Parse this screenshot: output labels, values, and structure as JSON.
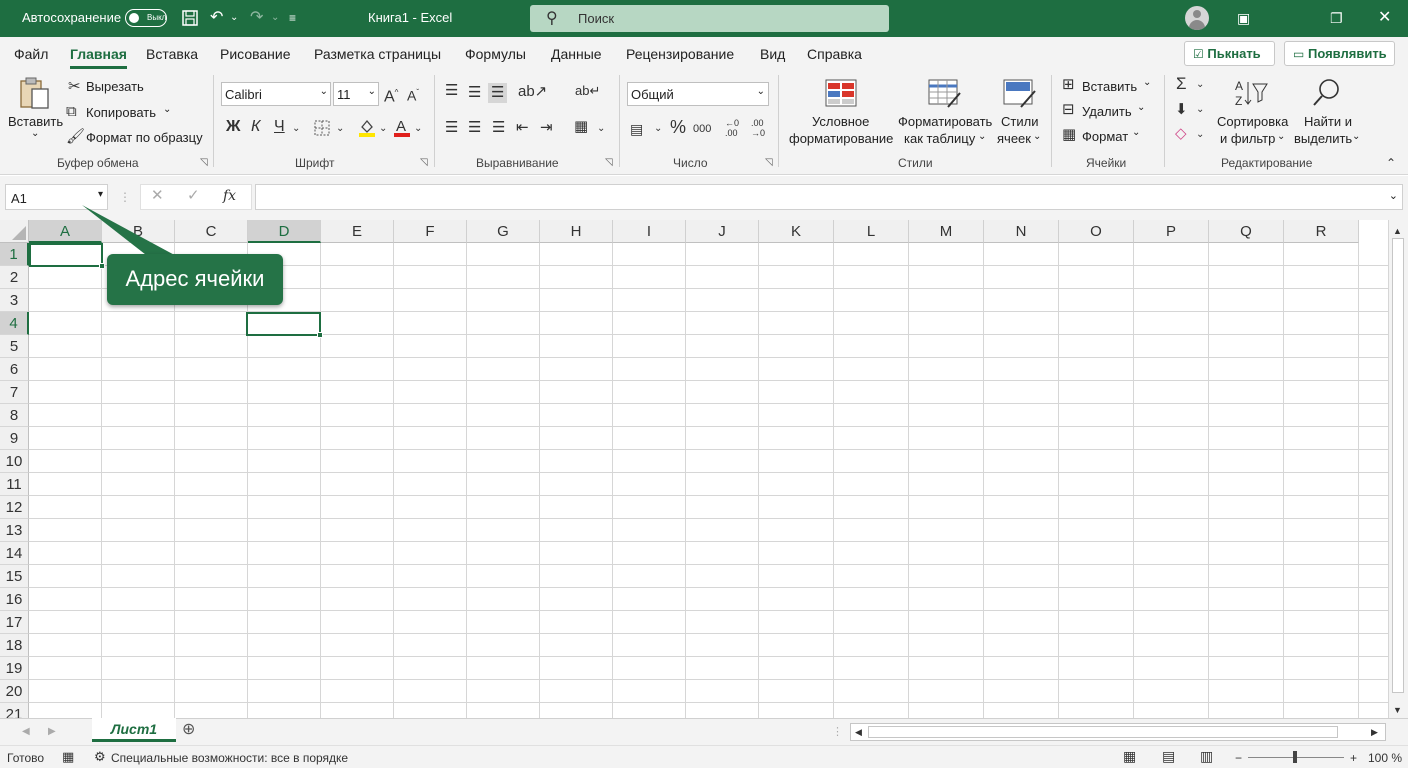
{
  "titlebar": {
    "autosave_label": "Автосохранение",
    "autosave_state": "Выкл",
    "doc_title": "Книга1  -  Excel",
    "search_placeholder": "Поиск",
    "bg_color": "#1e6e41"
  },
  "menu": {
    "items": [
      "Файл",
      "Главная",
      "Вставка",
      "Рисование",
      "Разметка страницы",
      "Формулы",
      "Данные",
      "Рецензирование",
      "Вид",
      "Справка"
    ],
    "active": "Главная",
    "share_button": "Пькнать",
    "comments_button": "Появлявить"
  },
  "ribbon": {
    "clipboard": {
      "paste": "Вставить",
      "cut": "Вырезать",
      "copy": "Копировать",
      "format_painter": "Формат по образцу",
      "group_label": "Буфер обмена"
    },
    "font": {
      "font_name": "Calibri",
      "font_size": "11",
      "bold": "Ж",
      "italic": "К",
      "underline": "Ч",
      "group_label": "Шрифт"
    },
    "alignment": {
      "group_label": "Выравнивание"
    },
    "number": {
      "format": "Общий",
      "percent": "%",
      "group_label": "Число"
    },
    "styles": {
      "conditional_line1": "Условное",
      "conditional_line2": "форматирование",
      "as_table_line1": "Форматировать",
      "as_table_line2": "как таблицу",
      "cell_styles_line1": "Стили",
      "cell_styles_line2": "ячеек",
      "group_label": "Стили"
    },
    "cells": {
      "insert": "Вставить",
      "delete": "Удалить",
      "format": "Формат",
      "group_label": "Ячейки"
    },
    "editing": {
      "sort_line1": "Сортировка",
      "sort_line2": "и фильтр",
      "find_line1": "Найти и",
      "find_line2": "выделить",
      "group_label": "Редактирование"
    }
  },
  "formula_bar": {
    "name_box": "A1",
    "fx": "fx",
    "formula": ""
  },
  "grid": {
    "columns": [
      "A",
      "B",
      "C",
      "D",
      "E",
      "F",
      "G",
      "H",
      "I",
      "J",
      "K",
      "L",
      "M",
      "N",
      "O",
      "P",
      "Q",
      "R"
    ],
    "rows": [
      "1",
      "2",
      "3",
      "4",
      "5",
      "6",
      "7",
      "8",
      "9",
      "10",
      "11",
      "12",
      "13",
      "14",
      "15",
      "16",
      "17",
      "18",
      "19",
      "20",
      "21"
    ],
    "active_cell": "A1",
    "selected_cell": "D4"
  },
  "callout": {
    "text": "Адрес ячейки",
    "color": "#257347"
  },
  "sheets": {
    "tabs": [
      "Лист1"
    ],
    "active": "Лист1"
  },
  "status": {
    "ready": "Готово",
    "accessibility": "Специальные возможности: все в порядке",
    "zoom": "100 %",
    "zoom_minus": "−",
    "zoom_plus": "+"
  }
}
